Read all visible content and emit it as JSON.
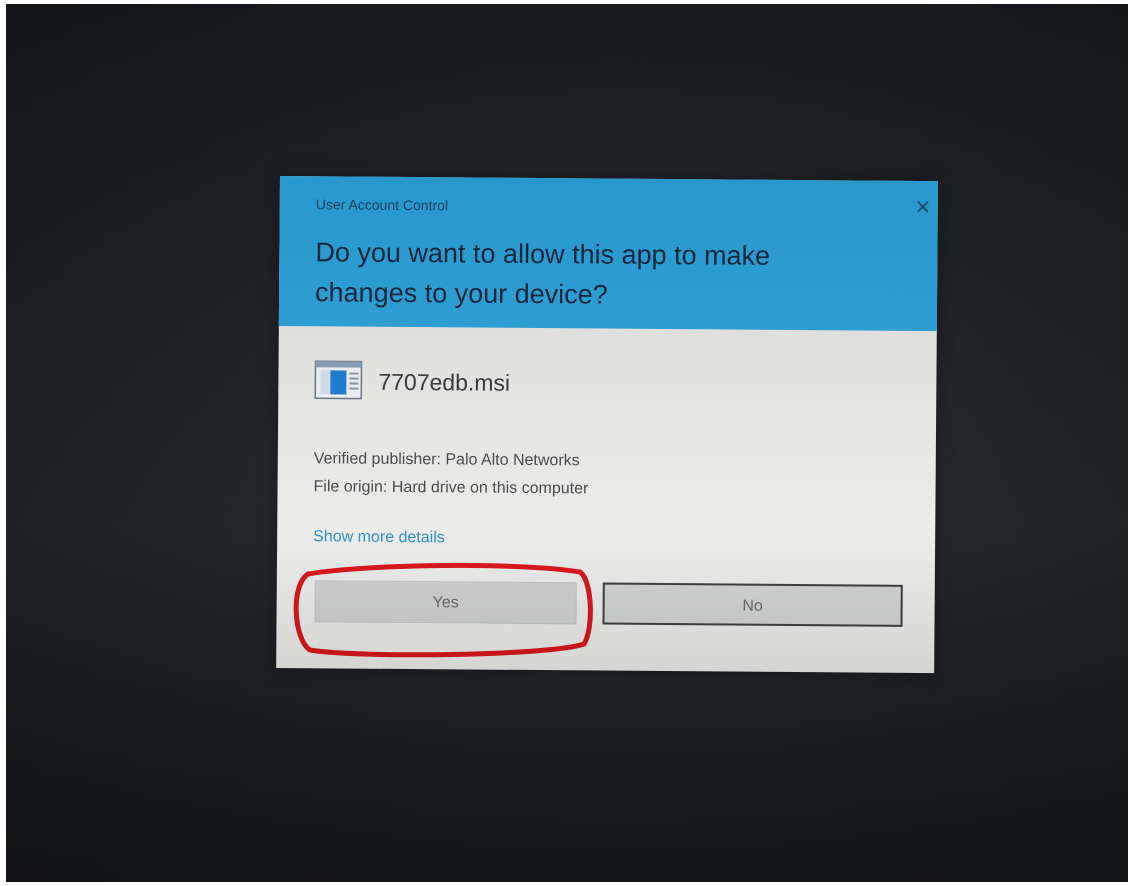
{
  "dialog": {
    "caption": "User Account Control",
    "close_glyph": "✕",
    "question": "Do you want to allow this app to make changes to your device?",
    "app_icon": "installer-window-icon",
    "app_name": "7707edb.msi",
    "publisher_line": "Verified publisher: Palo Alto Networks",
    "origin_line": "File origin: Hard drive on this computer",
    "details_link": "Show more details",
    "yes_label": "Yes",
    "no_label": "No"
  },
  "colors": {
    "header_blue": "#2fa6de",
    "body_bg": "#ececea",
    "link_blue": "#2b8fd0",
    "highlight_red": "#d9141a"
  }
}
